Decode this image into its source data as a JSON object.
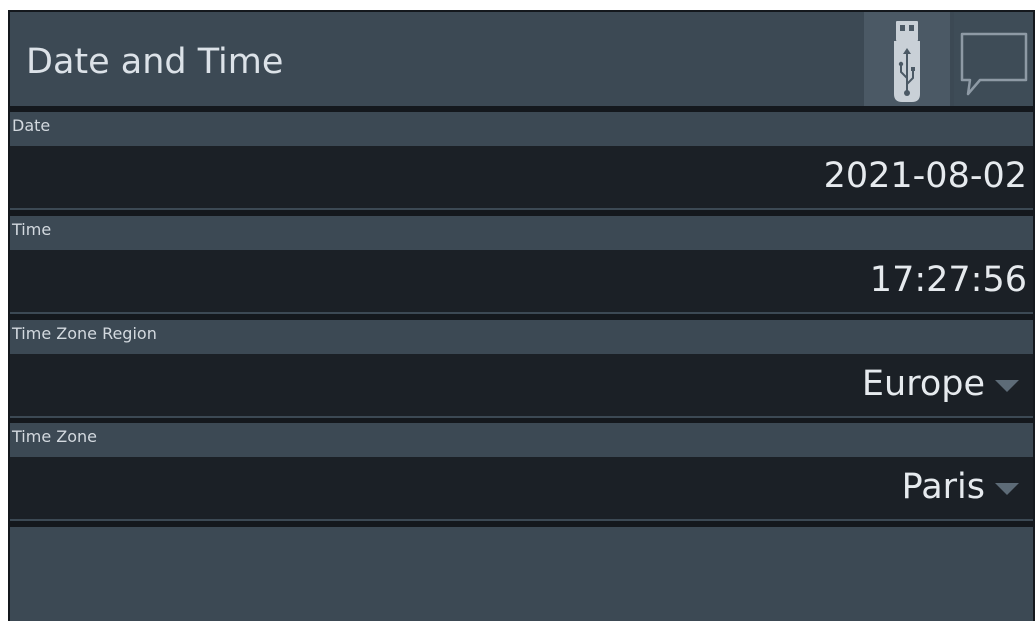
{
  "header": {
    "title": "Date and Time",
    "icons": [
      "usb-drive-icon",
      "message-icon"
    ]
  },
  "fields": [
    {
      "label": "Date",
      "value": "2021-08-02"
    },
    {
      "label": "Time",
      "value": "17:27:56"
    },
    {
      "label": "Time Zone Region",
      "value": "Europe"
    },
    {
      "label": "Time Zone",
      "value": "Paris"
    }
  ],
  "colors": {
    "background": "#14181d",
    "panel": "#3c4954",
    "value_field": "#1b2026",
    "text": "#e6eaee",
    "caret": "#5d6b77"
  }
}
